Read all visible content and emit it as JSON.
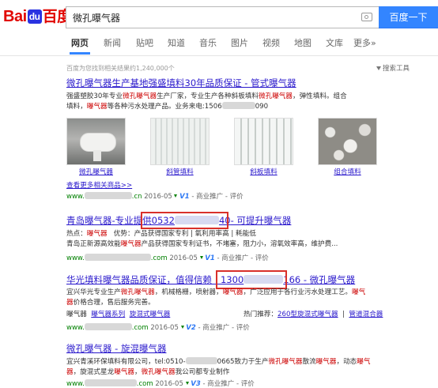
{
  "header": {
    "logo_bai": "Bai",
    "logo_du": "du",
    "logo_cn": "百度",
    "query": "微孔曝气器",
    "search_button": "百度一下"
  },
  "tabs": [
    "网页",
    "新闻",
    "贴吧",
    "知道",
    "音乐",
    "图片",
    "视频",
    "地图",
    "文库",
    "更多»"
  ],
  "stats": {
    "text": "百度为您找到相关结果约1,240,000个",
    "tools": "搜索工具"
  },
  "results": [
    {
      "title_prefix": "微孔曝气器",
      "title_rest": "生产基地强盛填料30年品质保证 - 管式曝气器",
      "snippet_1a": "强盛塑胶30年专业",
      "snippet_1b": "微孔曝气器",
      "snippet_1c": "生产厂家，专业生产各种斜板填料",
      "snippet_1d": "微孔曝气器",
      "snippet_1e": "，弹性填料。组合",
      "snippet_2a": "填料，",
      "snippet_2b": "曝气器",
      "snippet_2c": "等各种污水处理产品。业务来电:1506",
      "snippet_2d": "090",
      "images": [
        "微孔曝气器",
        "斜管填料",
        "斜板填料",
        "组合填料"
      ],
      "more": "查看更多相关商品>>",
      "url_a": "www.",
      "url_b": ".cn",
      "date": "2016-05",
      "v": "V1",
      "suffix": "- 商业推广 - 评价"
    },
    {
      "title_a": "青岛曝气器",
      "title_b": "-专业提",
      "title_c": "供0532",
      "title_d": "40",
      "title_e": "- 可提升",
      "title_f": "曝气器",
      "line1_a": "热点：",
      "line1_b": "曝气器",
      "line1_c": "优势：产品获得国家专利 | 氧利用率高 | 耗能低",
      "line2_a": "青岛正新源高效能",
      "line2_b": "曝气器",
      "line2_c": "产品获得国家专利证书，不堵塞，阻力小，溶氧效率高，维护费...",
      "url_a": "www.",
      "url_b": ".com",
      "date": "2016-05",
      "v": "V1",
      "suffix": "- 商业推广 - 评价"
    },
    {
      "title_a": "华光填料",
      "title_b": "曝气器",
      "title_c": "品质保证，值得信赖",
      "title_d": "1300",
      "title_e": "166",
      "title_f": "- ",
      "title_g": "微孔曝气器",
      "line1_a": "宜兴华光专业生产",
      "line1_b": "微孔曝气器",
      "line1_c": "，机械格栅，喷射器，",
      "line1_d": "曝气器",
      "line1_e": "，广泛应用于各行业污水处理工艺。",
      "line1_f": "曝气",
      "line2_a": "器",
      "line2_b": "价格合理，售后服务完善。",
      "sub_label": "曝气器",
      "sub_link1": "曝气器系列",
      "sub_link2": "旋混式曝气器",
      "hot_label": "热门推荐：",
      "hot_link1": "260型旋混式曝气器",
      "hot_link2": "管道混合器",
      "url_a": "www.",
      "url_b": ".com",
      "date": "2016-05",
      "v": "V2",
      "suffix": "- 商业推广 - 评价"
    },
    {
      "title_prefix": "微孔曝气器",
      "title_mid": " - 旋混",
      "title_end": "曝气器",
      "line1_a": "宜兴青溪环保填料有限公司，tel:0510-",
      "line1_b": "0665致力于生产",
      "line1_c": "微孔曝气器",
      "line1_d": "散流",
      "line1_e": "曝气器",
      "line1_f": "，动态",
      "line1_g": "曝气",
      "line2_a": "器",
      "line2_b": "，旋混式星龙",
      "line2_c": "曝气器",
      "line2_d": "，",
      "line2_e": "微孔曝气器",
      "line2_f": "我公司都专业制作",
      "url_a": "www.",
      "url_b": ".com",
      "date": "2016-05",
      "v": "V3",
      "suffix": "- 商业推广 - 评价"
    }
  ]
}
